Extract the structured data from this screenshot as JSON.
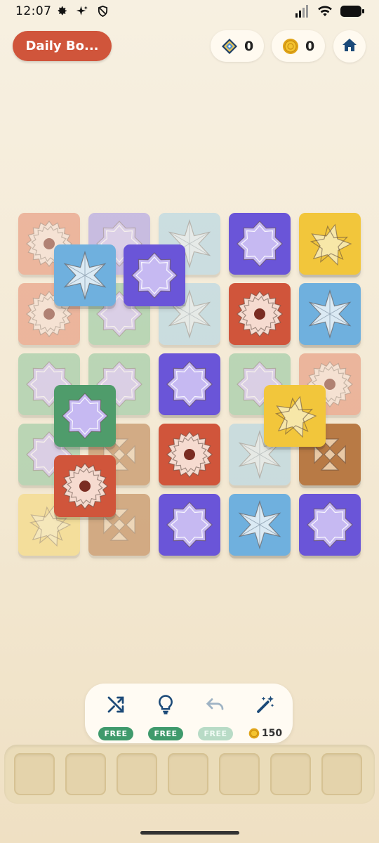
{
  "status_bar": {
    "time": "12:07"
  },
  "header": {
    "daily_button_label": "Daily Bo...",
    "gems_count": "0",
    "coins_count": "0"
  },
  "colors": {
    "red": "#d0553b",
    "salmon": "#e58a6d",
    "purple": "#6a55d8",
    "lavender": "#a596e6",
    "blue": "#6fb0de",
    "lightblue": "#a9d2e6",
    "green": "#4f9c6b",
    "lightgreen": "#8cc59b",
    "yellow": "#f2c63b",
    "lightyellow": "#f5d770",
    "brown": "#b87a45"
  },
  "tiles": [
    {
      "shape": "gear-icon",
      "color": "salmon",
      "dim": true
    },
    {
      "shape": "octagram-icon",
      "color": "lavender",
      "dim": true
    },
    {
      "shape": "hexagram-icon",
      "color": "lightblue",
      "dim": true
    },
    {
      "shape": "octagram-icon",
      "color": "purple",
      "dim": false
    },
    {
      "shape": "star-icon",
      "color": "yellow",
      "dim": false
    },
    {
      "shape": "gear-icon",
      "color": "salmon",
      "dim": true
    },
    {
      "shape": "octagram-icon",
      "color": "lightgreen",
      "dim": true
    },
    {
      "shape": "hexagram-icon",
      "color": "lightblue",
      "dim": true
    },
    {
      "shape": "gear-icon",
      "color": "red",
      "dim": false
    },
    {
      "shape": "hexagram-icon",
      "color": "blue",
      "dim": false
    },
    {
      "shape": "octagram-icon",
      "color": "lightgreen",
      "dim": true
    },
    {
      "shape": "octagram-icon",
      "color": "lightgreen",
      "dim": true
    },
    {
      "shape": "octagram-icon",
      "color": "purple",
      "dim": false
    },
    {
      "shape": "octagram-icon",
      "color": "lightgreen",
      "dim": true
    },
    {
      "shape": "gear-icon",
      "color": "salmon",
      "dim": true
    },
    {
      "shape": "octagram-icon",
      "color": "lightgreen",
      "dim": true
    },
    {
      "shape": "arrows-icon",
      "color": "brown",
      "dim": true
    },
    {
      "shape": "gear-icon",
      "color": "red",
      "dim": false
    },
    {
      "shape": "hexagram-icon",
      "color": "lightblue",
      "dim": true
    },
    {
      "shape": "arrows-icon",
      "color": "brown",
      "dim": false
    },
    {
      "shape": "star-icon",
      "color": "lightyellow",
      "dim": true
    },
    {
      "shape": "arrows-icon",
      "color": "brown",
      "dim": true
    },
    {
      "shape": "octagram-icon",
      "color": "purple",
      "dim": false
    },
    {
      "shape": "hexagram-icon",
      "color": "blue",
      "dim": false
    },
    {
      "shape": "octagram-icon",
      "color": "purple",
      "dim": false
    },
    {
      "shape": "hexagram-icon",
      "color": "blue",
      "dim": false
    },
    {
      "shape": "octagram-icon",
      "color": "purple",
      "dim": false
    },
    {
      "shape": "octagram-icon",
      "color": "green",
      "dim": false
    },
    {
      "shape": "star-icon",
      "color": "yellow",
      "dim": false
    },
    {
      "shape": "gear-icon",
      "color": "red",
      "dim": false
    }
  ],
  "tools": {
    "shuffle": {
      "badge": "FREE"
    },
    "hint": {
      "badge": "FREE"
    },
    "undo": {
      "badge": "FREE"
    },
    "magic": {
      "cost": "150"
    }
  },
  "tray_slots": 7
}
